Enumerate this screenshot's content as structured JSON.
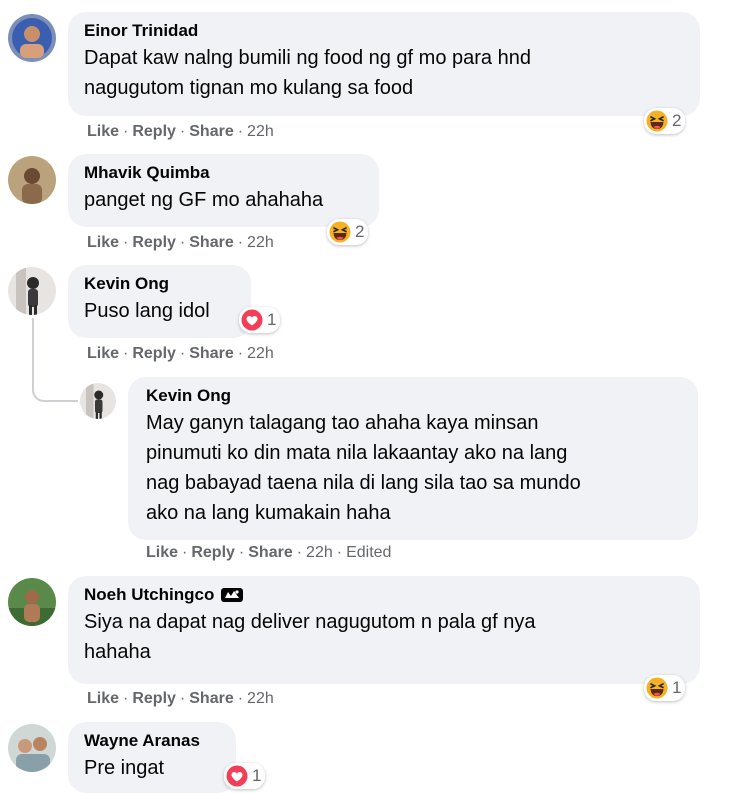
{
  "actions": {
    "like": "Like",
    "reply": "Reply",
    "share": "Share",
    "sep": "·"
  },
  "colors": {
    "bubble": "#f0f2f5",
    "muted": "#65676b",
    "heart": "#f33e58",
    "haha": "#f7b125"
  },
  "comments": [
    {
      "author": "Einor Trinidad",
      "lines": [
        "Dapat kaw nalng bumili ng food ng gf mo para hnd",
        "nagugutom tignan mo kulang sa food"
      ],
      "time": "22h",
      "reaction": {
        "icon": "haha-emoji-icon",
        "count": "2"
      }
    },
    {
      "author": "Mhavik Quimba",
      "lines": [
        "panget ng GF mo ahahaha"
      ],
      "time": "22h",
      "reaction": {
        "icon": "haha-emoji-icon",
        "count": "2"
      }
    },
    {
      "author": "Kevin Ong",
      "lines": [
        "Puso lang idol"
      ],
      "time": "22h",
      "reaction": {
        "icon": "heart-reaction-icon",
        "count": "1"
      }
    },
    {
      "author": "Kevin Ong",
      "lines": [
        "May ganyn talagang tao ahaha kaya minsan",
        "pinumuti ko din mata nila lakaantay ako na lang",
        "nag babayad taena nila di lang sila tao sa mundo",
        "ako na lang kumakain haha"
      ],
      "time": "22h",
      "edited": "Edited"
    },
    {
      "author": "Noeh Utchingco",
      "badge": "top-fan-badge-icon",
      "lines": [
        "Siya na dapat nag deliver nagugutom n pala gf nya",
        "hahaha"
      ],
      "time": "22h",
      "reaction": {
        "icon": "haha-emoji-icon",
        "count": "1"
      }
    },
    {
      "author": "Wayne Aranas",
      "lines": [
        "Pre ingat"
      ],
      "reaction": {
        "icon": "heart-reaction-icon",
        "count": "1"
      }
    }
  ]
}
